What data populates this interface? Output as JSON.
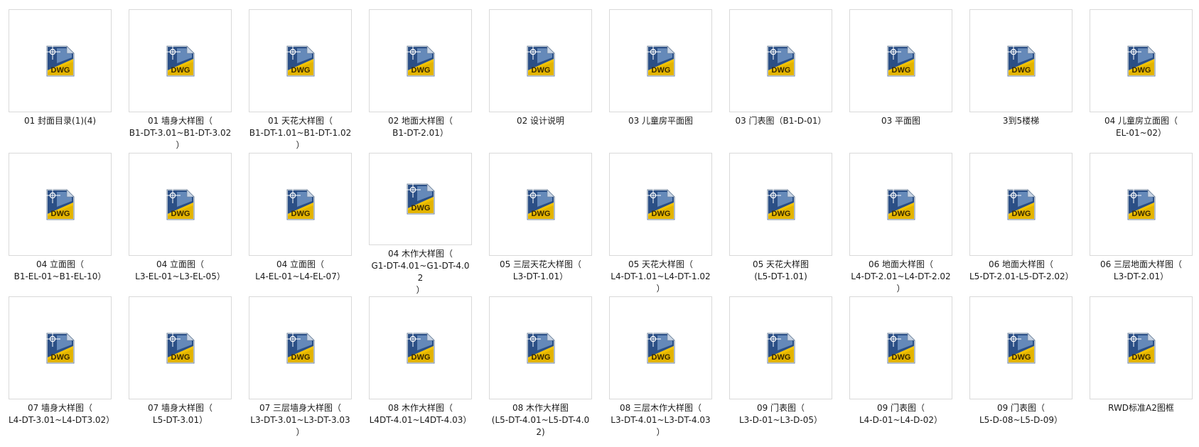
{
  "icon": {
    "name": "dwg-file-icon",
    "badge_text": "DWG",
    "colors": {
      "blue_dark": "#2b4f86",
      "blue_light": "#7fa2cf",
      "gold": "#f2c200",
      "gold_dark": "#b78d00"
    }
  },
  "files": [
    {
      "name": "01 封面目录(1)(4)"
    },
    {
      "name": "01 墙身大样图（\nB1-DT-3.01~B1-DT-3.02\n）"
    },
    {
      "name": "01 天花大样图（\nB1-DT-1.01~B1-DT-1.02\n）"
    },
    {
      "name": "02 地面大样图（\nB1-DT-2.01）"
    },
    {
      "name": "02 设计说明"
    },
    {
      "name": "03 儿童房平面图"
    },
    {
      "name": "03 门表图（B1-D-01）"
    },
    {
      "name": "03 平面图"
    },
    {
      "name": "3到5楼梯"
    },
    {
      "name": "04 儿童房立面图（\nEL-01~02）"
    },
    {
      "name": "04 立面图（\nB1-EL-01~B1-EL-10）"
    },
    {
      "name": "04 立面图（\nL3-EL-01~L3-EL-05）"
    },
    {
      "name": "04 立面图（\nL4-EL-01~L4-EL-07）"
    },
    {
      "name": "04 木作大样图（\nG1-DT-4.01~G1-DT-4.02\n）"
    },
    {
      "name": "05 三层天花大样图（\nL3-DT-1.01）"
    },
    {
      "name": "05 天花大样图（\nL4-DT-1.01~L4-DT-1.02\n）"
    },
    {
      "name": "05 天花大样图\n(L5-DT-1.01)"
    },
    {
      "name": "06 地面大样图（\nL4-DT-2.01~L4-DT-2.02\n）"
    },
    {
      "name": "06 地面大样图（\nL5-DT-2.01-L5-DT-2.02）"
    },
    {
      "name": "06 三层地面大样图（\nL3-DT-2.01）"
    },
    {
      "name": "07 墙身大样图（\nL4-DT-3.01~L4-DT3.02）"
    },
    {
      "name": "07 墙身大样图（\nL5-DT-3.01）"
    },
    {
      "name": "07 三层墙身大样图（\nL3-DT-3.01~L3-DT-3.03\n）"
    },
    {
      "name": "08 木作大样图（\nL4DT-4.01~L4DT-4.03）"
    },
    {
      "name": "08 木作大样图\n(L5-DT-4.01~L5-DT-4.02)"
    },
    {
      "name": "08 三层木作大样图（\nL3-DT-4.01~L3-DT-4.03\n）"
    },
    {
      "name": "09 门表图（\nL3-D-01~L3-D-05）"
    },
    {
      "name": "09 门表图（\nL4-D-01~L4-D-02）"
    },
    {
      "name": "09 门表图（\nL5-D-08~L5-D-09）"
    },
    {
      "name": "RWD标准A2图框"
    }
  ]
}
